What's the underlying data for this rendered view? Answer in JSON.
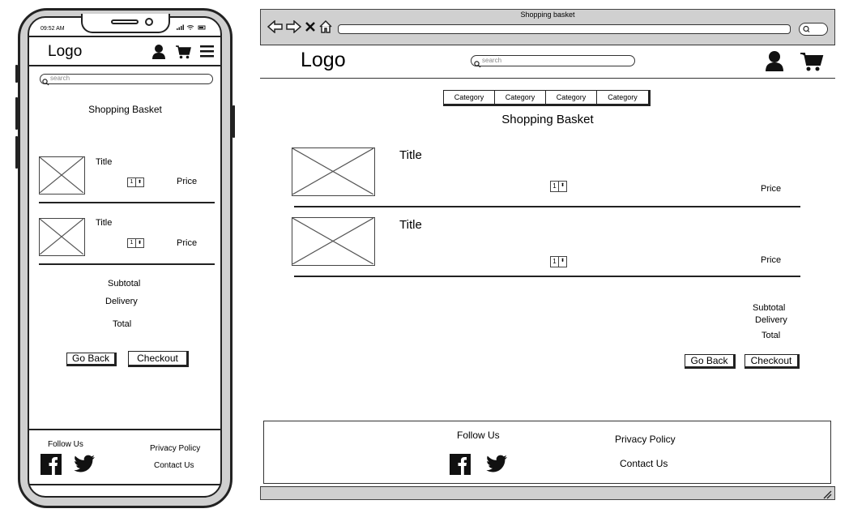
{
  "window": {
    "title": "Shopping basket"
  },
  "phone": {
    "status_time": "09:52 AM",
    "header": {
      "logo": "Logo"
    },
    "search": {
      "placeholder": "search"
    },
    "page_title": "Shopping Basket",
    "items": [
      {
        "title": "Title",
        "qty": "1",
        "price": "Price"
      },
      {
        "title": "Title",
        "qty": "1",
        "price": "Price"
      }
    ],
    "summary": {
      "subtotal": "Subtotal",
      "delivery": "Delivery",
      "total": "Total"
    },
    "buttons": {
      "back": "Go Back",
      "checkout": "Checkout"
    },
    "footer": {
      "follow": "Follow Us",
      "privacy": "Privacy Policy",
      "contact": "Contact Us"
    }
  },
  "desktop": {
    "header": {
      "logo": "Logo"
    },
    "search": {
      "placeholder": "search"
    },
    "categories": [
      "Category",
      "Category",
      "Category",
      "Category"
    ],
    "page_title": "Shopping Basket",
    "items": [
      {
        "title": "Title",
        "qty": "1",
        "price": "Price"
      },
      {
        "title": "Title",
        "qty": "1",
        "price": "Price"
      }
    ],
    "summary": {
      "subtotal": "Subtotal",
      "delivery": "Delivery",
      "total": "Total"
    },
    "buttons": {
      "back": "Go Back",
      "checkout": "Checkout"
    },
    "footer": {
      "follow": "Follow Us",
      "privacy": "Privacy Policy",
      "contact": "Contact Us"
    }
  },
  "icons": [
    "back-arrow-icon",
    "forward-arrow-icon",
    "close-icon",
    "home-icon",
    "user-icon",
    "cart-icon",
    "menu-icon",
    "search-icon",
    "facebook-icon",
    "twitter-icon",
    "resize-grip-icon"
  ]
}
